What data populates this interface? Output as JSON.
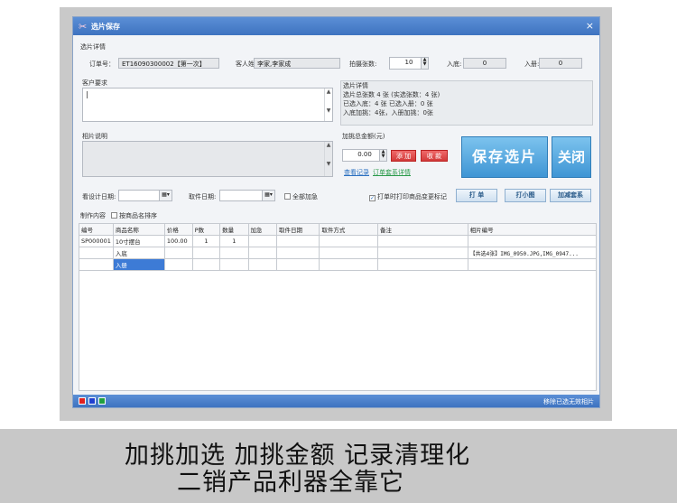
{
  "window": {
    "title": "选片保存",
    "close_glyph": "×"
  },
  "detail_section": {
    "label": "选片详情",
    "order_label": "订单号：",
    "order_value": "ET16090300002【第一次】",
    "customer_label": "客人姓名:",
    "customer_value": "李家,李家成",
    "shots_label": "拍摄张数:",
    "shots_value": "10",
    "into_base_label": "入底:",
    "into_base_value": "0",
    "into_album_label": "入册:",
    "into_album_value": "0"
  },
  "requirements": {
    "label": "客户要求",
    "value": "|"
  },
  "selection_detail": {
    "label": "选片详情",
    "line1": "选片总张数 4 张 (实选张数：4 张)",
    "line2": "已选入底：4 张 已选入册：0 张",
    "line3": "入底加挑：4张，入册加挑：0张"
  },
  "photo_notes": {
    "label": "相片说明"
  },
  "extra_amount": {
    "label": "加挑总金额(元)",
    "value": "0.00",
    "add_button": "添 加",
    "charge_button": "收 款",
    "view_records_link": "查看记录",
    "order_detail_link": "订单套系详情"
  },
  "big_buttons": {
    "save": "保存选片",
    "close": "关闭"
  },
  "options_row": {
    "design_date_label": "看设计日期:",
    "pickup_date_label": "取件日期:",
    "all_urgent_label": "全部加急",
    "print_mark_label": "打单时打印商品变更标记",
    "print_button": "打 单",
    "print_small_button": "打小图",
    "add_package_button": "加减套系"
  },
  "production": {
    "label": "制作内容",
    "sort_label": "按商品名排序"
  },
  "table": {
    "headers": [
      "编号",
      "商品名称",
      "价格",
      "P数",
      "数量",
      "加急",
      "取件日期",
      "取件方式",
      "备注",
      "相片编号"
    ],
    "rows": [
      [
        "SP000001",
        "10寸摆台",
        "100.00",
        "1",
        "1",
        "",
        "",
        "",
        "",
        ""
      ],
      [
        "",
        "入底",
        "",
        "",
        "",
        "",
        "",
        "",
        "",
        "【共选4张】IMG_0950.JPG,IMG_0947..."
      ],
      [
        "",
        "入册",
        "",
        "",
        "",
        "",
        "",
        "",
        "",
        ""
      ]
    ]
  },
  "statusbar": {
    "right_text": "移除已选无效相片",
    "swatches": [
      "#e02020",
      "#2040d0",
      "#20a040"
    ]
  },
  "caption": {
    "line1": "加挑加选 加挑金额 记录清理化",
    "line2": "二销产品利器全靠它"
  },
  "colors": {
    "accent_blue": "#3e73c0",
    "red_button": "#d33a3a",
    "big_button": "#3f95d4"
  }
}
